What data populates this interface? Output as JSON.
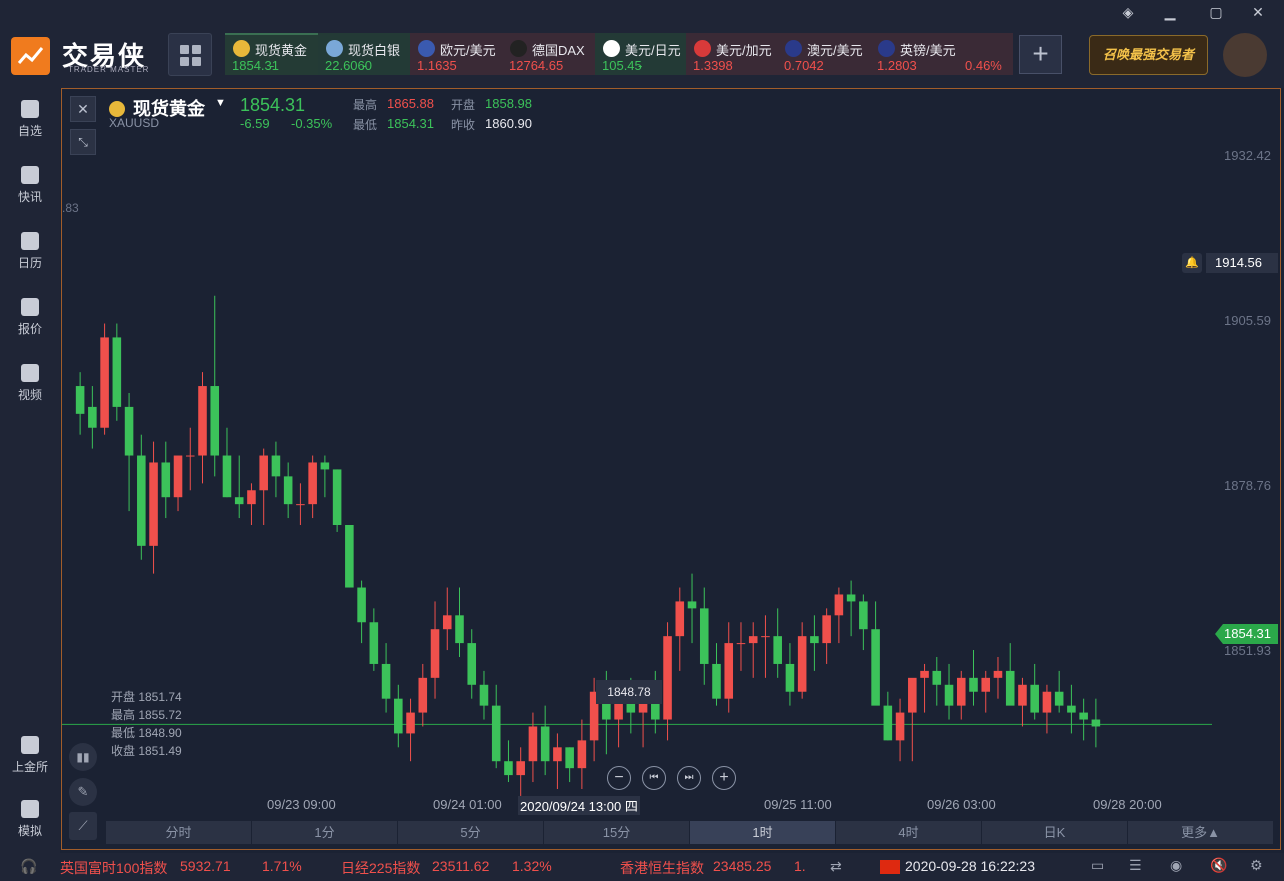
{
  "app": {
    "logo_text": "交易侠",
    "logo_sub": "TRADER MASTER",
    "banner": "召唤最强交易者"
  },
  "tabs": [
    {
      "name": "现货黄金",
      "price": "1854.31",
      "chg": "-",
      "dir": "green",
      "flag": "#e8b83a"
    },
    {
      "name": "现货白银",
      "price": "22.6060",
      "chg": "-",
      "dir": "green",
      "flag": "#7aa8d8"
    },
    {
      "name": "欧元/美元",
      "price": "1.1635",
      "chg": "",
      "dir": "red",
      "flag": "#3a5ab0"
    },
    {
      "name": "德国DAX",
      "price": "12764.65",
      "chg": "",
      "dir": "red",
      "flag": "#222222"
    },
    {
      "name": "美元/日元",
      "price": "105.45",
      "chg": "-",
      "dir": "green",
      "flag": "#ffffff"
    },
    {
      "name": "美元/加元",
      "price": "1.3398",
      "chg": "",
      "dir": "red",
      "flag": "#d83a3a"
    },
    {
      "name": "澳元/美元",
      "price": "0.7042",
      "chg": "",
      "dir": "red",
      "flag": "#2a3a8a"
    },
    {
      "name": "英镑/美元",
      "price": "1.2803",
      "chg": "0.46%",
      "dir": "red",
      "flag": "#2a3a8a"
    }
  ],
  "sidebar": [
    {
      "label": "自选",
      "icon": "bookmark-icon"
    },
    {
      "label": "快讯",
      "icon": "news-icon"
    },
    {
      "label": "日历",
      "icon": "calendar-icon"
    },
    {
      "label": "报价",
      "icon": "quote-icon"
    },
    {
      "label": "视频",
      "icon": "video-icon"
    },
    {
      "label": "上金所",
      "icon": "sge-icon"
    },
    {
      "label": "模拟",
      "icon": "wallet-icon"
    }
  ],
  "symbol": {
    "name": "现货黄金",
    "code": "XAUUSD",
    "price": "1854.31",
    "change": "-6.59",
    "change_pct": "-0.35%",
    "high_label": "最高",
    "high": "1865.88",
    "open_label": "开盘",
    "open": "1858.98",
    "low_label": "最低",
    "low": "1854.31",
    "prev_label": "昨收",
    "prev": "1860.90"
  },
  "ohlc_panel": {
    "open": "开盘 1851.74",
    "high": "最高 1855.72",
    "low": "最低 1848.90",
    "close": "收盘 1851.49"
  },
  "axis": {
    "y_labels": [
      "1932.42",
      "1905.59",
      "1878.76",
      "1851.93"
    ],
    "alert_price": "1914.56",
    "current_price": "1854.31",
    "min_marker": "1848.78",
    "left_cut_label": ".83",
    "x_labels": [
      "09/23 09:00",
      "09/24 01:00",
      "09/25 11:00",
      "09/26 03:00",
      "09/28 20:00"
    ],
    "crosshair_time": "2020/09/24 13:00 四"
  },
  "timeframes": [
    "分时",
    "1分",
    "5分",
    "15分",
    "1时",
    "4时",
    "日K",
    "更多▲"
  ],
  "active_timeframe": "1时",
  "ticker": {
    "items": [
      {
        "name": "英国富时100指数",
        "value": "5932.71",
        "chg": "1.71%"
      },
      {
        "name": "日经225指数",
        "value": "23511.62",
        "chg": "1.32%"
      },
      {
        "name": "香港恒生指数",
        "value": "23485.25",
        "chg": "1."
      }
    ],
    "datetime": "2020-09-28 16:22:23"
  },
  "chart_data": {
    "type": "candlestick",
    "ylim": [
      1845,
      1940
    ],
    "candles": [
      [
        1903,
        1905,
        1896,
        1899
      ],
      [
        1900,
        1903,
        1894,
        1897
      ],
      [
        1897,
        1912,
        1896,
        1910
      ],
      [
        1910,
        1912,
        1898,
        1900
      ],
      [
        1900,
        1902,
        1885,
        1893
      ],
      [
        1893,
        1896,
        1878,
        1880
      ],
      [
        1880,
        1895,
        1876,
        1892
      ],
      [
        1892,
        1895,
        1884,
        1887
      ],
      [
        1887,
        1893,
        1885,
        1893
      ],
      [
        1893,
        1897,
        1888,
        1893
      ],
      [
        1893,
        1905,
        1889,
        1903
      ],
      [
        1903,
        1916,
        1890,
        1893
      ],
      [
        1893,
        1897,
        1887,
        1887
      ],
      [
        1887,
        1893,
        1884,
        1886
      ],
      [
        1886,
        1889,
        1883,
        1888
      ],
      [
        1888,
        1894,
        1883,
        1893
      ],
      [
        1893,
        1895,
        1887,
        1890
      ],
      [
        1890,
        1892,
        1884,
        1886
      ],
      [
        1886,
        1889,
        1883,
        1886
      ],
      [
        1886,
        1893,
        1884,
        1892
      ],
      [
        1892,
        1893,
        1887,
        1891
      ],
      [
        1891,
        1891,
        1882,
        1883
      ],
      [
        1883,
        1883,
        1874,
        1874
      ],
      [
        1874,
        1875,
        1866,
        1869
      ],
      [
        1869,
        1871,
        1862,
        1863
      ],
      [
        1863,
        1866,
        1856,
        1858
      ],
      [
        1858,
        1860,
        1851,
        1853
      ],
      [
        1853,
        1858,
        1849,
        1856
      ],
      [
        1856,
        1863,
        1854,
        1861
      ],
      [
        1861,
        1872,
        1858,
        1868
      ],
      [
        1868,
        1874,
        1865,
        1870
      ],
      [
        1870,
        1874,
        1864,
        1866
      ],
      [
        1866,
        1868,
        1858,
        1860
      ],
      [
        1860,
        1862,
        1855,
        1857
      ],
      [
        1857,
        1860,
        1848,
        1849
      ],
      [
        1849,
        1852,
        1846,
        1847
      ],
      [
        1847,
        1851,
        1844,
        1849
      ],
      [
        1849,
        1856,
        1846,
        1854
      ],
      [
        1854,
        1857,
        1847,
        1849
      ],
      [
        1849,
        1853,
        1845,
        1851
      ],
      [
        1851,
        1851,
        1846,
        1848
      ],
      [
        1848,
        1855,
        1845,
        1852
      ],
      [
        1852,
        1861,
        1849,
        1859
      ],
      [
        1859,
        1862,
        1850,
        1855
      ],
      [
        1855,
        1860,
        1851,
        1858
      ],
      [
        1858,
        1861,
        1853,
        1856
      ],
      [
        1856,
        1860,
        1851,
        1859
      ],
      [
        1859,
        1862,
        1853,
        1855
      ],
      [
        1855,
        1869,
        1852,
        1867
      ],
      [
        1867,
        1874,
        1862,
        1872
      ],
      [
        1872,
        1876,
        1866,
        1871
      ],
      [
        1871,
        1874,
        1860,
        1863
      ],
      [
        1863,
        1866,
        1857,
        1858
      ],
      [
        1858,
        1869,
        1856,
        1866
      ],
      [
        1866,
        1869,
        1862,
        1866
      ],
      [
        1866,
        1869,
        1861,
        1867
      ],
      [
        1867,
        1870,
        1861,
        1867
      ],
      [
        1867,
        1871,
        1861,
        1863
      ],
      [
        1863,
        1866,
        1857,
        1859
      ],
      [
        1859,
        1869,
        1858,
        1867
      ],
      [
        1867,
        1870,
        1862,
        1866
      ],
      [
        1866,
        1871,
        1863,
        1870
      ],
      [
        1870,
        1874,
        1866,
        1873
      ],
      [
        1873,
        1875,
        1867,
        1872
      ],
      [
        1872,
        1873,
        1865,
        1868
      ],
      [
        1868,
        1872,
        1861,
        1857
      ],
      [
        1857,
        1859,
        1852,
        1852
      ],
      [
        1852,
        1858,
        1849,
        1856
      ],
      [
        1856,
        1859,
        1849,
        1861
      ],
      [
        1861,
        1863,
        1856,
        1862
      ],
      [
        1862,
        1864,
        1857,
        1860
      ],
      [
        1860,
        1863,
        1855,
        1857
      ],
      [
        1857,
        1862,
        1855,
        1861
      ],
      [
        1861,
        1865,
        1857,
        1859
      ],
      [
        1859,
        1862,
        1856,
        1861
      ],
      [
        1861,
        1864,
        1858,
        1862
      ],
      [
        1862,
        1866,
        1858,
        1857
      ],
      [
        1857,
        1861,
        1854,
        1860
      ],
      [
        1860,
        1863,
        1855,
        1856
      ],
      [
        1856,
        1860,
        1853,
        1859
      ],
      [
        1859,
        1862,
        1856,
        1857
      ],
      [
        1857,
        1860,
        1853,
        1856
      ],
      [
        1856,
        1858,
        1852,
        1855
      ],
      [
        1855,
        1858,
        1851,
        1854
      ]
    ]
  }
}
